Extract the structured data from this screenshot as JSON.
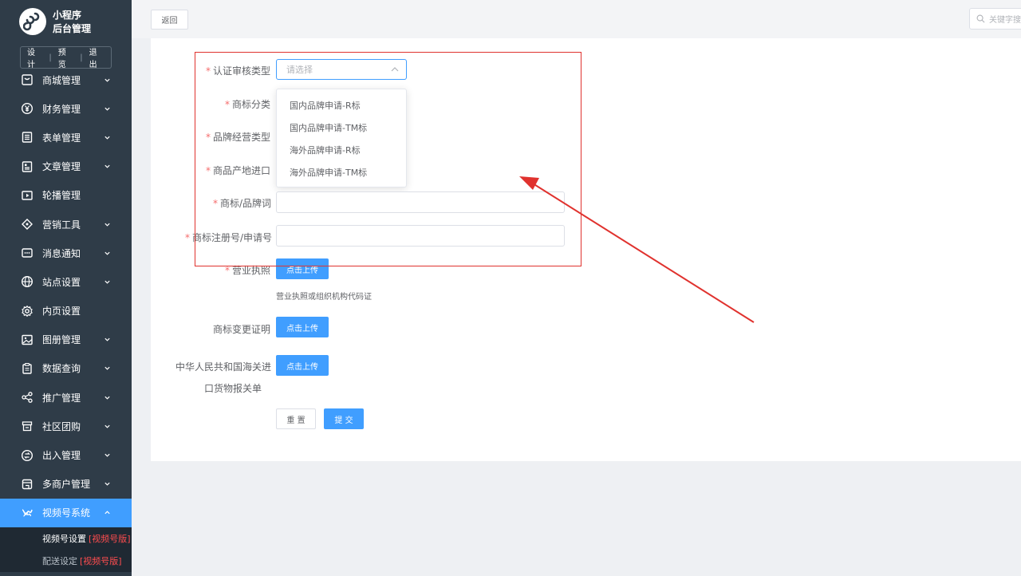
{
  "sidebar": {
    "logo_line1": "小程序",
    "logo_line2": "后台管理",
    "links": [
      "设计",
      "预览",
      "退出"
    ],
    "items": [
      {
        "label": "商城管理",
        "icon": "shop-icon",
        "has_children": true
      },
      {
        "label": "财务管理",
        "icon": "yen-icon",
        "has_children": true
      },
      {
        "label": "表单管理",
        "icon": "form-icon",
        "has_children": true
      },
      {
        "label": "文章管理",
        "icon": "article-icon",
        "has_children": true
      },
      {
        "label": "轮播管理",
        "icon": "carousel-icon",
        "has_children": false
      },
      {
        "label": "营销工具",
        "icon": "tag-icon",
        "has_children": true
      },
      {
        "label": "消息通知",
        "icon": "message-icon",
        "has_children": true
      },
      {
        "label": "站点设置",
        "icon": "globe-icon",
        "has_children": true
      },
      {
        "label": "内页设置",
        "icon": "gear-icon",
        "has_children": false
      },
      {
        "label": "图册管理",
        "icon": "image-icon",
        "has_children": true
      },
      {
        "label": "数据查询",
        "icon": "clipboard-icon",
        "has_children": true
      },
      {
        "label": "推广管理",
        "icon": "share-icon",
        "has_children": true
      },
      {
        "label": "社区团购",
        "icon": "store-icon",
        "has_children": true
      },
      {
        "label": "出入管理",
        "icon": "exchange-icon",
        "has_children": true
      },
      {
        "label": "多商户管理",
        "icon": "merchant-icon",
        "has_children": true
      },
      {
        "label": "视频号系统",
        "icon": "video-icon",
        "has_children": true,
        "active": true
      }
    ],
    "subitems": [
      {
        "label": "视频号设置",
        "tag": "[视频号版]"
      },
      {
        "label": "配送设定",
        "tag": "[视频号版]"
      }
    ]
  },
  "topbar": {
    "back_label": "返回",
    "search_placeholder": "关键字搜"
  },
  "form": {
    "fields": {
      "audit_type": {
        "label": "认证审核类型",
        "required": true,
        "placeholder": "请选择"
      },
      "category": {
        "label": "商标分类",
        "required": true
      },
      "brand_type": {
        "label": "品牌经营类型",
        "required": true
      },
      "origin_import": {
        "label": "商品产地进口",
        "required": true
      },
      "brand_word": {
        "label": "商标/品牌词",
        "required": true,
        "value": ""
      },
      "reg_number": {
        "label": "商标注册号/申请号",
        "required": true,
        "value": ""
      },
      "license": {
        "label": "营业执照",
        "required": true,
        "hint": "营业执照或组织机构代码证"
      },
      "change_cert": {
        "label": "商标变更证明",
        "required": false
      },
      "customs_line1": "中华人民共和国海关进",
      "customs_line2": "口货物报关单"
    },
    "upload_label": "点击上传",
    "dropdown_options": [
      "国内品牌申请-R标",
      "国内品牌申请-TM标",
      "海外品牌申请-R标",
      "海外品牌申请-TM标"
    ],
    "reset_label": "重 置",
    "submit_label": "提 交"
  },
  "colors": {
    "sidebar_bg": "#2f3c48",
    "primary": "#409eff",
    "required": "#f56c6c",
    "annotation": "#e0322e"
  }
}
